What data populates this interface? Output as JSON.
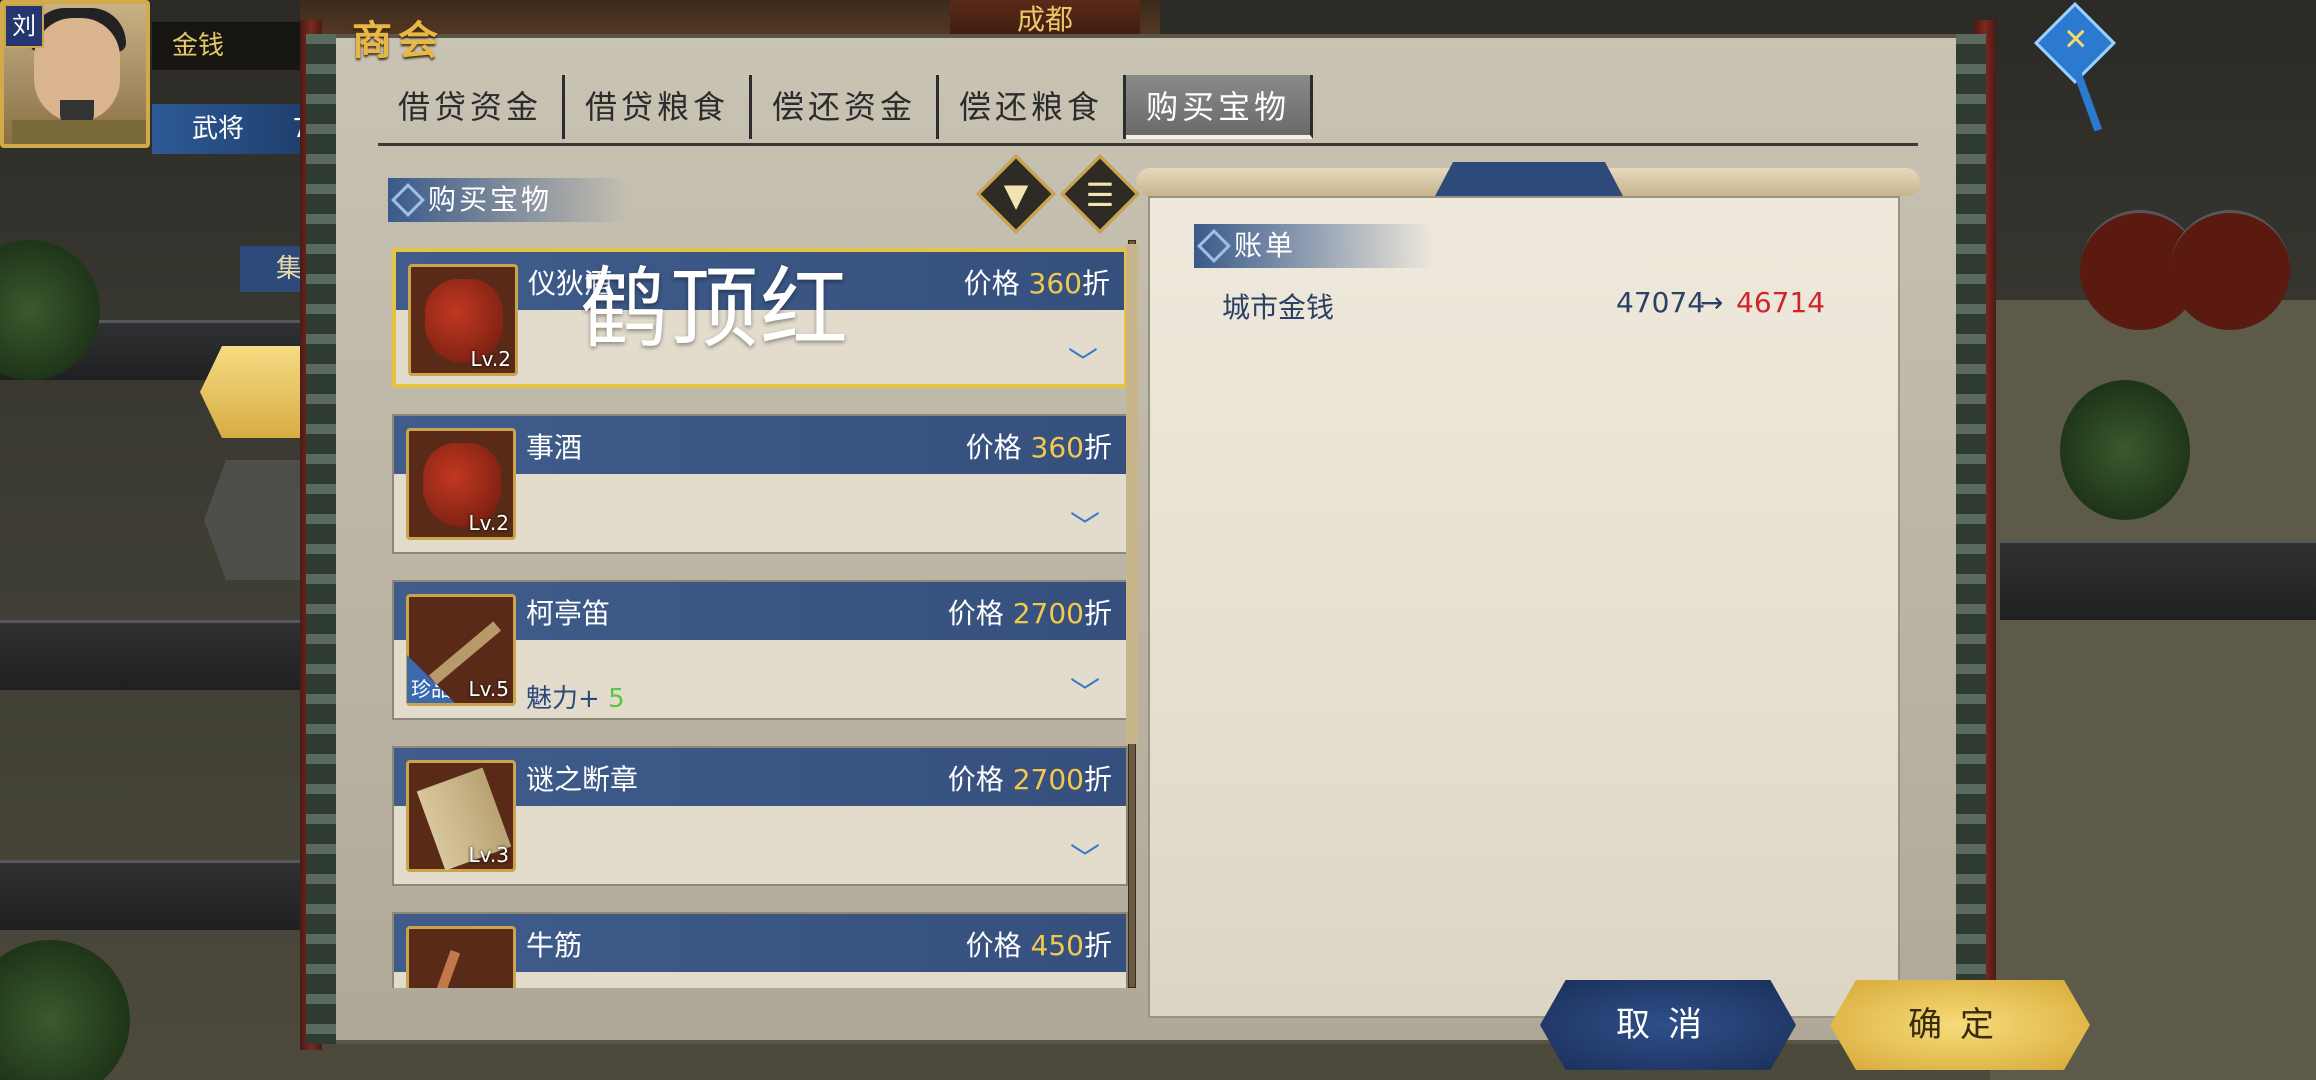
{
  "hud": {
    "player_badge": "刘",
    "gold_label": "金钱",
    "general_label": "武将",
    "general_value": "7",
    "gather_label": "集",
    "city_name": "成都"
  },
  "panel": {
    "title": "商会",
    "tabs": [
      {
        "label": "借贷资金",
        "active": false
      },
      {
        "label": "借贷粮食",
        "active": false
      },
      {
        "label": "偿还资金",
        "active": false
      },
      {
        "label": "偿还粮食",
        "active": false
      },
      {
        "label": "购买宝物",
        "active": true
      }
    ],
    "list_header": "购买宝物",
    "filter_icon": "filter-icon",
    "sort_icon": "list-icon",
    "price_label": "价格",
    "price_suffix": "折",
    "items": [
      {
        "name": "仪狄酒",
        "price": "360",
        "level": "Lv.2",
        "icon": "wine-jar-icon",
        "selected": true,
        "stat": "",
        "bonus": ""
      },
      {
        "name": "事酒",
        "price": "360",
        "level": "Lv.2",
        "icon": "wine-jar-icon",
        "selected": false,
        "stat": "",
        "bonus": ""
      },
      {
        "name": "柯亭笛",
        "price": "2700",
        "level": "Lv.5",
        "icon": "flute-icon",
        "selected": false,
        "stat": "魅力+",
        "bonus": "5",
        "rare_tag": "珍品"
      },
      {
        "name": "谜之断章",
        "price": "2700",
        "level": "Lv.3",
        "icon": "scroll-icon",
        "selected": false,
        "stat": "",
        "bonus": ""
      },
      {
        "name": "牛筋",
        "price": "450",
        "level": "",
        "icon": "sticks-icon",
        "selected": false,
        "stat": "",
        "bonus": ""
      }
    ]
  },
  "watermark": "鹤顶红",
  "bill": {
    "header": "账单",
    "label": "城市金钱",
    "from": "47074",
    "arrow": "→",
    "to": "46714",
    "to_color": "#d0242a"
  },
  "buttons": {
    "cancel": "取消",
    "confirm": "确定"
  }
}
